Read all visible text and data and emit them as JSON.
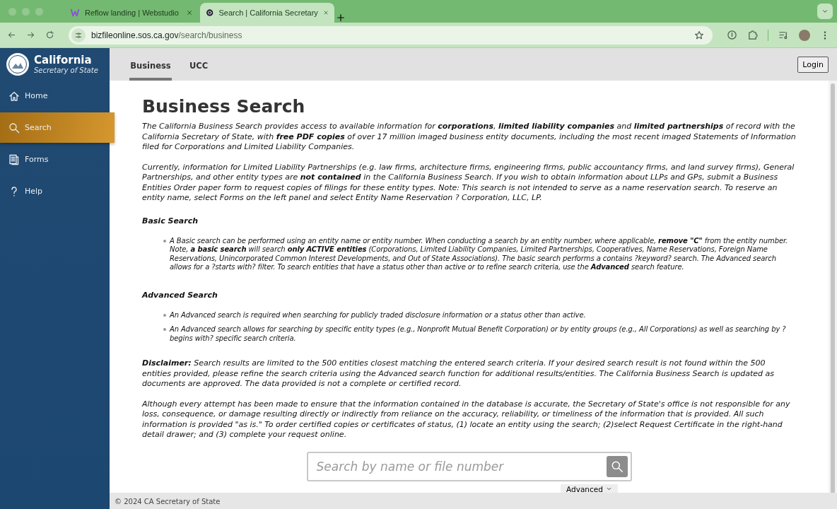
{
  "browser": {
    "tabs": [
      {
        "title": "Reflow landing | Webstudio",
        "selected": false
      },
      {
        "title": "Search | California Secretary",
        "selected": true
      }
    ],
    "url_host": "bizfileonline.sos.ca.gov",
    "url_path": "/search/business"
  },
  "sidebar": {
    "logo_title": "California",
    "logo_subtitle": "Secretary of State",
    "items": [
      {
        "label": "Home",
        "selected": false
      },
      {
        "label": "Search",
        "selected": true
      },
      {
        "label": "Forms",
        "selected": false
      },
      {
        "label": "Help",
        "selected": false
      }
    ]
  },
  "header": {
    "tabs": [
      {
        "label": "Business",
        "selected": true
      },
      {
        "label": "UCC",
        "selected": false
      }
    ],
    "login": "Login"
  },
  "main": {
    "title": "Business Search",
    "blocks": [
      {
        "kind": "paragraph",
        "text": "The California Business Search provides access to available information for **corporations**, **limited liability companies** and **limited partnerships** of record with the California Secretary of State, with **free PDF copies** of over 17 million imaged business entity documents, including the most recent imaged Statements of Information filed for Corporations and Limited Liability Companies."
      },
      {
        "kind": "paragraph",
        "text": "Currently, information for Limited Liability Partnerships (e.g. law firms, architecture firms, engineering firms, public accountancy firms, and land survey firms), General Partnerships, and other entity types are **not contained** in the California Business Search. If you wish to obtain information about LLPs and GPs, submit a Business Entities Order paper form to request copies of filings for these entity types. Note: This search is not intended to serve as a name reservation search. To reserve an entity name, select Forms on the left panel and select Entity Name Reservation ? Corporation, LLC, LP."
      },
      {
        "kind": "heading",
        "text": "Basic Search"
      },
      {
        "kind": "bullets",
        "items": [
          "A Basic search can be performed using an entity name or entity number. When conducting a search by an entity number, where applicable, **remove \"C\"** from the entity number. Note, **a basic search** will search **only ACTIVE entities** (Corporations, Limited Liability Companies, Limited Partnerships, Cooperatives, Name Reservations, Foreign Name Reservations, Unincorporated Common Interest Developments, and Out of State Associations). The basic search performs a contains ?keyword? search. The Advanced search allows for a ?starts with? filter. To search entities that have a status other than active or to refine search criteria, use the **Advanced** search feature."
        ]
      },
      {
        "kind": "heading",
        "text": "Advanced Search"
      },
      {
        "kind": "bullets",
        "items": [
          "An Advanced search is required when searching for publicly traded disclosure information or a status other than active.",
          "An Advanced search allows for searching by specific entity types (e.g., Nonprofit Mutual Benefit Corporation) or by entity groups (e.g., All Corporations) as well as searching by ?begins with? specific search criteria."
        ]
      },
      {
        "kind": "paragraph",
        "text": "**Disclaimer:** Search results are limited to the 500 entities closest matching the entered search criteria. If your desired search result is not found within the 500 entities provided, please refine the search criteria using the Advanced search function for additional results/entities. The California Business Search is updated as documents are approved. The data provided is not a complete or certified record."
      },
      {
        "kind": "paragraph",
        "text": "Although every attempt has been made to ensure that the information contained in the database is accurate, the Secretary of State's office is not responsible for any loss, consequence, or damage resulting directly or indirectly from reliance on the accuracy, reliability, or timeliness of the information that is provided. All such information is provided \"as is.\" To order certified copies or certificates of status, (1) locate an entity using the search; (2)select Request Certificate in the right-hand detail drawer; and (3) complete your request online."
      }
    ],
    "search": {
      "placeholder": "Search by name or file number"
    },
    "advanced": "Advanced"
  },
  "footer": "© 2024 CA Secretary of State"
}
